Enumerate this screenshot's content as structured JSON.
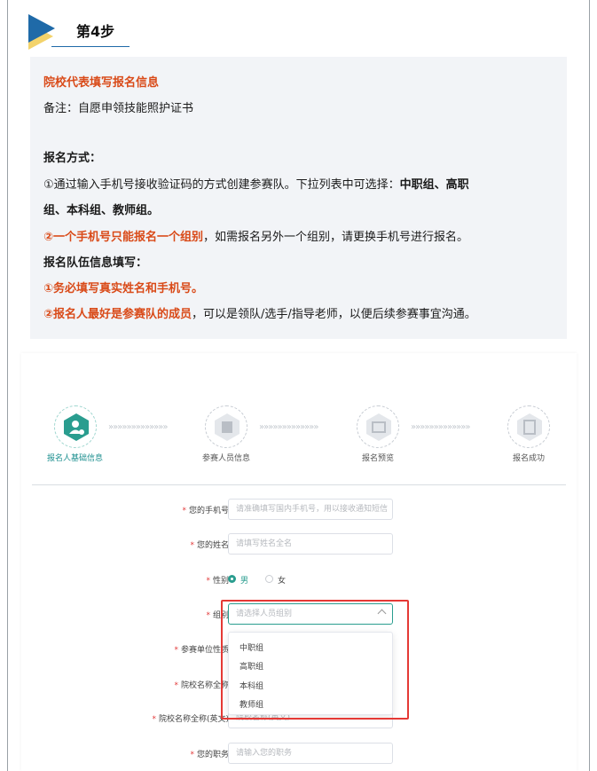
{
  "step": {
    "title": "第4步"
  },
  "info": {
    "heading": "院校代表填写报名信息",
    "note": "备注：自愿申领技能照护证书",
    "method_title": "报名方式：",
    "line1_a": "①通过输入手机号接收验证码的方式创建参赛队。下拉列表中可选择：",
    "line1_b": "中职组、高职",
    "line2": "组、本科组、教师组。",
    "line3_a": "②",
    "line3_b": "一个手机号只能报名一个组别",
    "line3_c": "，如需报名另外一个组别，请更换手机号进行报名。",
    "team_title": "报名队伍信息填写：",
    "line4_a": "①",
    "line4_b": "务必填写真实姓名和手机号。",
    "line5_a": "②",
    "line5_b": "报名人最好是参赛队的成员",
    "line5_c": "，可以是领队/选手/指导老师，以便后续参赛事宜沟通。"
  },
  "progress": {
    "steps": [
      {
        "label": "报名人基础信息"
      },
      {
        "label": "参赛人员信息"
      },
      {
        "label": "报名预览"
      },
      {
        "label": "报名成功"
      }
    ],
    "chevron_text": "»»»»»»»»»»»»»"
  },
  "form": {
    "phone": {
      "label": "您的手机号",
      "placeholder": "请准确填写国内手机号，用以接收通知短信"
    },
    "name": {
      "label": "您的姓名",
      "placeholder": "请填写姓名全名"
    },
    "gender": {
      "label": "性别",
      "male": "男",
      "female": "女",
      "selected": "男"
    },
    "group": {
      "label": "组别",
      "placeholder": "请选择人员组别",
      "options": [
        "中职组",
        "高职组",
        "本科组",
        "教师组"
      ]
    },
    "unit_type": {
      "label": "参赛单位性质"
    },
    "school_cn": {
      "label": "院校名称全称"
    },
    "school_en": {
      "label": "院校名称全称(英文)",
      "placeholder": "院校名称(英文)"
    },
    "position": {
      "label": "您的职务",
      "placeholder": "请输入您的职务"
    }
  },
  "colors": {
    "accent": "#2a9d8f",
    "warning_red": "#d94a18",
    "highlight": "#e53935",
    "flag_blue": "#1f6aa8",
    "flag_yellow": "#f3d36b"
  }
}
